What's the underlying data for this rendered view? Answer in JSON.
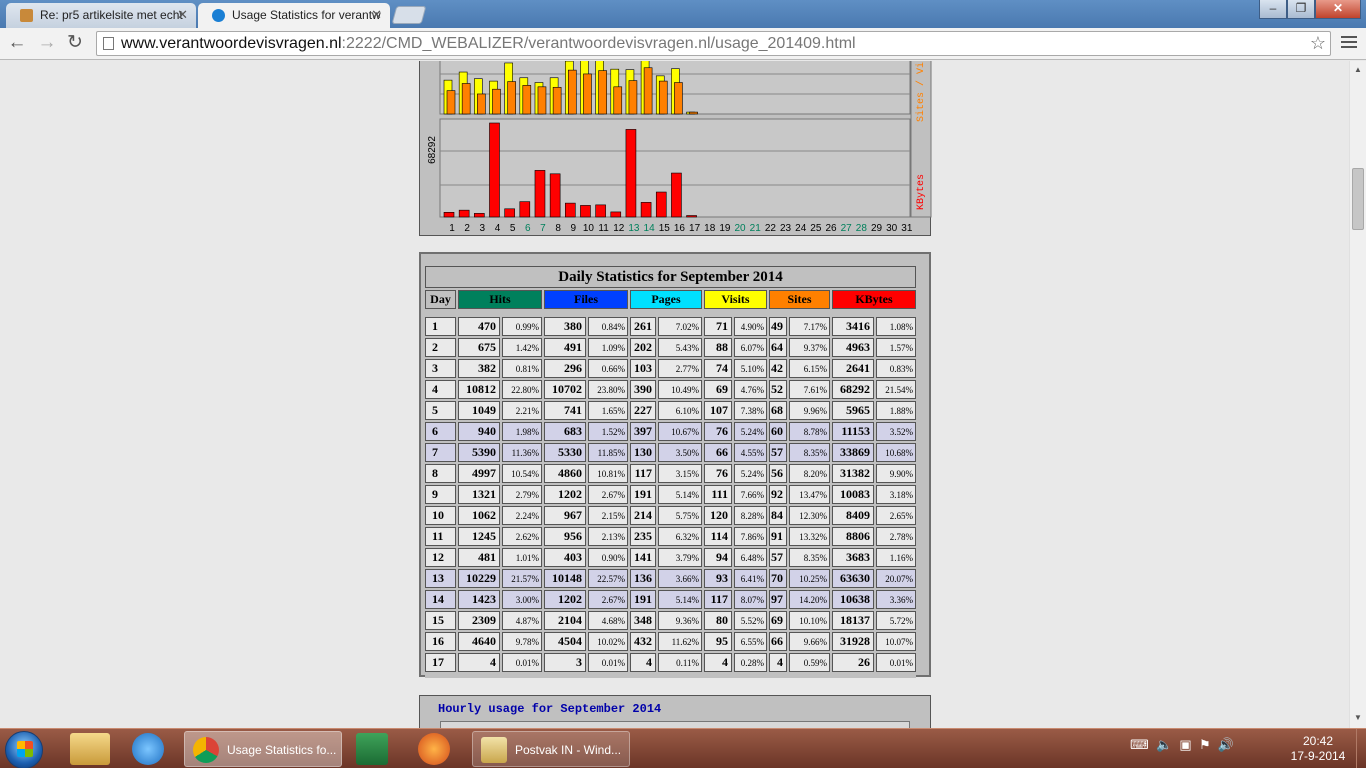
{
  "tabs": [
    {
      "label": "Re: pr5 artikelsite met echt",
      "active": false
    },
    {
      "label": "Usage Statistics for verantw",
      "active": true
    }
  ],
  "omnibox": {
    "host": "www.verantwoordevisvragen.nl",
    "path": ":2222/CMD_WEBALIZER/verantwoordevisvragen.nl/usage_201409.html"
  },
  "chart_data": [
    {
      "type": "bar",
      "title": "",
      "right_labels": {
        "sites": "Sites",
        "visits_fragment": "Vi",
        "sep": " / ",
        "kbytes": "KBytes"
      },
      "kbytes_axis_label": "68292",
      "categories": [
        "1",
        "2",
        "3",
        "4",
        "5",
        "6",
        "7",
        "8",
        "9",
        "10",
        "11",
        "12",
        "13",
        "14",
        "15",
        "16",
        "17",
        "18",
        "19",
        "20",
        "21",
        "22",
        "23",
        "24",
        "25",
        "26",
        "27",
        "28",
        "29",
        "30",
        "31"
      ],
      "weekend_days": [
        "6",
        "7",
        "13",
        "14",
        "20",
        "21",
        "27",
        "28"
      ],
      "colors": {
        "kbytes": "#ff0000",
        "visits": "#ffff00",
        "sites": "#ff8000",
        "bg": "#c0c0c0"
      },
      "series": [
        {
          "name": "Sites",
          "values": [
            49,
            64,
            42,
            52,
            68,
            60,
            57,
            56,
            92,
            84,
            91,
            57,
            70,
            97,
            69,
            66,
            4,
            0,
            0,
            0,
            0,
            0,
            0,
            0,
            0,
            0,
            0,
            0,
            0,
            0,
            0
          ]
        },
        {
          "name": "Visits",
          "values": [
            71,
            88,
            74,
            69,
            107,
            76,
            66,
            76,
            111,
            120,
            114,
            94,
            93,
            117,
            80,
            95,
            4,
            0,
            0,
            0,
            0,
            0,
            0,
            0,
            0,
            0,
            0,
            0,
            0,
            0,
            0
          ]
        },
        {
          "name": "KBytes",
          "values": [
            3416,
            4963,
            2641,
            68292,
            5965,
            11153,
            33869,
            31382,
            10083,
            8409,
            8806,
            3683,
            63630,
            10638,
            18137,
            31928,
            26,
            0,
            0,
            0,
            0,
            0,
            0,
            0,
            0,
            0,
            0,
            0,
            0,
            0,
            0
          ]
        }
      ]
    },
    {
      "type": "table",
      "title": "Daily Statistics for September 2014",
      "headers": [
        {
          "label": "Day",
          "color": "#c0c0c0"
        },
        {
          "label": "Hits",
          "color": "#00805c"
        },
        {
          "label": "Files",
          "color": "#0040ff"
        },
        {
          "label": "Pages",
          "color": "#00e0ff"
        },
        {
          "label": "Visits",
          "color": "#ffff00"
        },
        {
          "label": "Sites",
          "color": "#ff8000"
        },
        {
          "label": "KBytes",
          "color": "#ff0000"
        }
      ],
      "rows": [
        {
          "day": "1",
          "hits": "470",
          "hits_p": "0.99%",
          "files": "380",
          "files_p": "0.84%",
          "pages": "261",
          "pages_p": "7.02%",
          "visits": "71",
          "visits_p": "4.90%",
          "sites": "49",
          "sites_p": "7.17%",
          "kb": "3416",
          "kb_p": "1.08%",
          "hl": false
        },
        {
          "day": "2",
          "hits": "675",
          "hits_p": "1.42%",
          "files": "491",
          "files_p": "1.09%",
          "pages": "202",
          "pages_p": "5.43%",
          "visits": "88",
          "visits_p": "6.07%",
          "sites": "64",
          "sites_p": "9.37%",
          "kb": "4963",
          "kb_p": "1.57%",
          "hl": false
        },
        {
          "day": "3",
          "hits": "382",
          "hits_p": "0.81%",
          "files": "296",
          "files_p": "0.66%",
          "pages": "103",
          "pages_p": "2.77%",
          "visits": "74",
          "visits_p": "5.10%",
          "sites": "42",
          "sites_p": "6.15%",
          "kb": "2641",
          "kb_p": "0.83%",
          "hl": false
        },
        {
          "day": "4",
          "hits": "10812",
          "hits_p": "22.80%",
          "files": "10702",
          "files_p": "23.80%",
          "pages": "390",
          "pages_p": "10.49%",
          "visits": "69",
          "visits_p": "4.76%",
          "sites": "52",
          "sites_p": "7.61%",
          "kb": "68292",
          "kb_p": "21.54%",
          "hl": false
        },
        {
          "day": "5",
          "hits": "1049",
          "hits_p": "2.21%",
          "files": "741",
          "files_p": "1.65%",
          "pages": "227",
          "pages_p": "6.10%",
          "visits": "107",
          "visits_p": "7.38%",
          "sites": "68",
          "sites_p": "9.96%",
          "kb": "5965",
          "kb_p": "1.88%",
          "hl": false
        },
        {
          "day": "6",
          "hits": "940",
          "hits_p": "1.98%",
          "files": "683",
          "files_p": "1.52%",
          "pages": "397",
          "pages_p": "10.67%",
          "visits": "76",
          "visits_p": "5.24%",
          "sites": "60",
          "sites_p": "8.78%",
          "kb": "11153",
          "kb_p": "3.52%",
          "hl": true
        },
        {
          "day": "7",
          "hits": "5390",
          "hits_p": "11.36%",
          "files": "5330",
          "files_p": "11.85%",
          "pages": "130",
          "pages_p": "3.50%",
          "visits": "66",
          "visits_p": "4.55%",
          "sites": "57",
          "sites_p": "8.35%",
          "kb": "33869",
          "kb_p": "10.68%",
          "hl": true
        },
        {
          "day": "8",
          "hits": "4997",
          "hits_p": "10.54%",
          "files": "4860",
          "files_p": "10.81%",
          "pages": "117",
          "pages_p": "3.15%",
          "visits": "76",
          "visits_p": "5.24%",
          "sites": "56",
          "sites_p": "8.20%",
          "kb": "31382",
          "kb_p": "9.90%",
          "hl": false
        },
        {
          "day": "9",
          "hits": "1321",
          "hits_p": "2.79%",
          "files": "1202",
          "files_p": "2.67%",
          "pages": "191",
          "pages_p": "5.14%",
          "visits": "111",
          "visits_p": "7.66%",
          "sites": "92",
          "sites_p": "13.47%",
          "kb": "10083",
          "kb_p": "3.18%",
          "hl": false
        },
        {
          "day": "10",
          "hits": "1062",
          "hits_p": "2.24%",
          "files": "967",
          "files_p": "2.15%",
          "pages": "214",
          "pages_p": "5.75%",
          "visits": "120",
          "visits_p": "8.28%",
          "sites": "84",
          "sites_p": "12.30%",
          "kb": "8409",
          "kb_p": "2.65%",
          "hl": false
        },
        {
          "day": "11",
          "hits": "1245",
          "hits_p": "2.62%",
          "files": "956",
          "files_p": "2.13%",
          "pages": "235",
          "pages_p": "6.32%",
          "visits": "114",
          "visits_p": "7.86%",
          "sites": "91",
          "sites_p": "13.32%",
          "kb": "8806",
          "kb_p": "2.78%",
          "hl": false
        },
        {
          "day": "12",
          "hits": "481",
          "hits_p": "1.01%",
          "files": "403",
          "files_p": "0.90%",
          "pages": "141",
          "pages_p": "3.79%",
          "visits": "94",
          "visits_p": "6.48%",
          "sites": "57",
          "sites_p": "8.35%",
          "kb": "3683",
          "kb_p": "1.16%",
          "hl": false
        },
        {
          "day": "13",
          "hits": "10229",
          "hits_p": "21.57%",
          "files": "10148",
          "files_p": "22.57%",
          "pages": "136",
          "pages_p": "3.66%",
          "visits": "93",
          "visits_p": "6.41%",
          "sites": "70",
          "sites_p": "10.25%",
          "kb": "63630",
          "kb_p": "20.07%",
          "hl": true
        },
        {
          "day": "14",
          "hits": "1423",
          "hits_p": "3.00%",
          "files": "1202",
          "files_p": "2.67%",
          "pages": "191",
          "pages_p": "5.14%",
          "visits": "117",
          "visits_p": "8.07%",
          "sites": "97",
          "sites_p": "14.20%",
          "kb": "10638",
          "kb_p": "3.36%",
          "hl": true
        },
        {
          "day": "15",
          "hits": "2309",
          "hits_p": "4.87%",
          "files": "2104",
          "files_p": "4.68%",
          "pages": "348",
          "pages_p": "9.36%",
          "visits": "80",
          "visits_p": "5.52%",
          "sites": "69",
          "sites_p": "10.10%",
          "kb": "18137",
          "kb_p": "5.72%",
          "hl": false
        },
        {
          "day": "16",
          "hits": "4640",
          "hits_p": "9.78%",
          "files": "4504",
          "files_p": "10.02%",
          "pages": "432",
          "pages_p": "11.62%",
          "visits": "95",
          "visits_p": "6.55%",
          "sites": "66",
          "sites_p": "9.66%",
          "kb": "31928",
          "kb_p": "10.07%",
          "hl": false
        },
        {
          "day": "17",
          "hits": "4",
          "hits_p": "0.01%",
          "files": "3",
          "files_p": "0.01%",
          "pages": "4",
          "pages_p": "0.11%",
          "visits": "4",
          "visits_p": "0.28%",
          "sites": "4",
          "sites_p": "0.59%",
          "kb": "26",
          "kb_p": "0.01%",
          "hl": false
        }
      ]
    }
  ],
  "hourly": {
    "title": "Hourly usage for September 2014"
  },
  "taskbar": {
    "tasks": [
      {
        "label": "Usage Statistics fo...",
        "active": true
      },
      {
        "label": "Postvak IN - Wind...",
        "active": false
      }
    ],
    "clock_time": "20:42",
    "clock_date": "17-9-2014"
  }
}
